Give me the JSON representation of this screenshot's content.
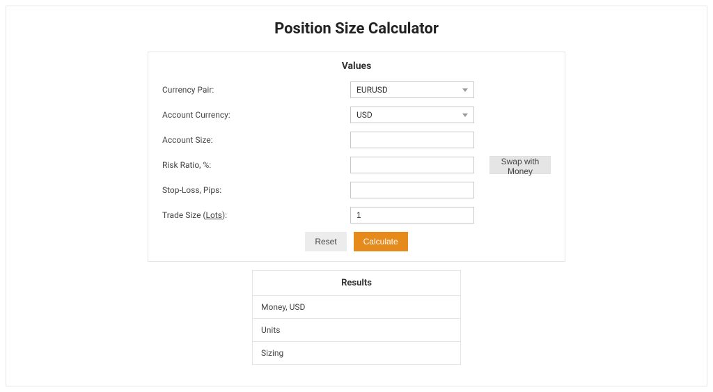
{
  "title": "Position Size Calculator",
  "values": {
    "heading": "Values",
    "currencyPair": {
      "label": "Currency Pair:",
      "value": "EURUSD"
    },
    "accountCurrency": {
      "label": "Account Currency:",
      "value": "USD"
    },
    "accountSize": {
      "label": "Account Size:",
      "value": ""
    },
    "riskRatio": {
      "label": "Risk Ratio, %:",
      "value": "",
      "swapBtn": "Swap with Money"
    },
    "stopLoss": {
      "label": "Stop-Loss, Pips:",
      "value": ""
    },
    "tradeSize": {
      "labelPrefix": "Trade Size (",
      "labelLots": "Lots",
      "labelSuffix": "):",
      "value": "1"
    },
    "buttons": {
      "reset": "Reset",
      "calculate": "Calculate"
    }
  },
  "results": {
    "heading": "Results",
    "moneyLabel": "Money, USD",
    "unitsLabel": "Units",
    "sizingLabel": "Sizing"
  }
}
